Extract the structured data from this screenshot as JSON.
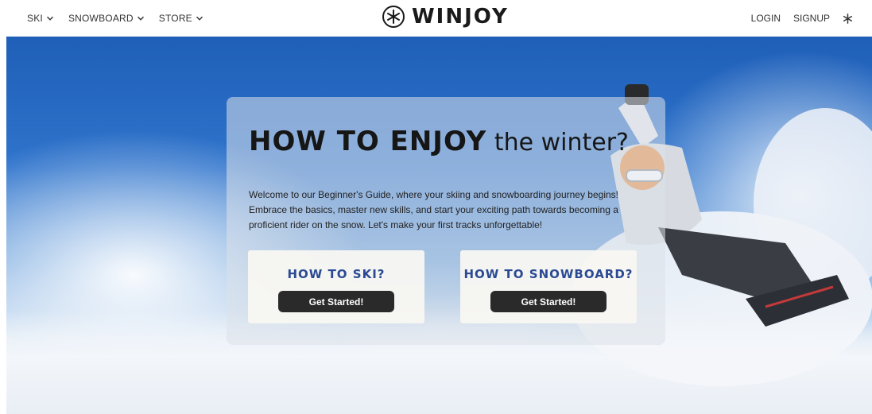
{
  "nav": {
    "left_items": [
      {
        "label": "SKI",
        "icon": "chevron-down-icon"
      },
      {
        "label": "SNOWBOARD",
        "icon": "chevron-down-icon"
      },
      {
        "label": "STORE",
        "icon": "chevron-down-icon"
      }
    ],
    "brand": {
      "name": "WINJOY",
      "logo_icon": "snowflake-circle-icon"
    },
    "right_items": [
      {
        "label": "LOGIN"
      },
      {
        "label": "SIGNUP"
      }
    ],
    "theme_toggle_icon": "snowflake-icon"
  },
  "hero": {
    "headline_strong": "HOW TO ENJOY",
    "headline_light": " the winter?",
    "intro": "Welcome to our Beginner's Guide, where your skiing and snowboarding journey begins! Embrace the basics, master new skills, and start your exciting path towards becoming a proficient rider on the snow. Let's make your first tracks unforgettable!",
    "options": [
      {
        "title": "HOW TO SKI?",
        "button": "Get Started!"
      },
      {
        "title": "HOW TO SNOWBOARD?",
        "button": "Get Started!"
      }
    ]
  },
  "colors": {
    "accent_title": "#2b4a93",
    "button_bg": "#2a2a2a",
    "sky": "#2f74cc"
  }
}
